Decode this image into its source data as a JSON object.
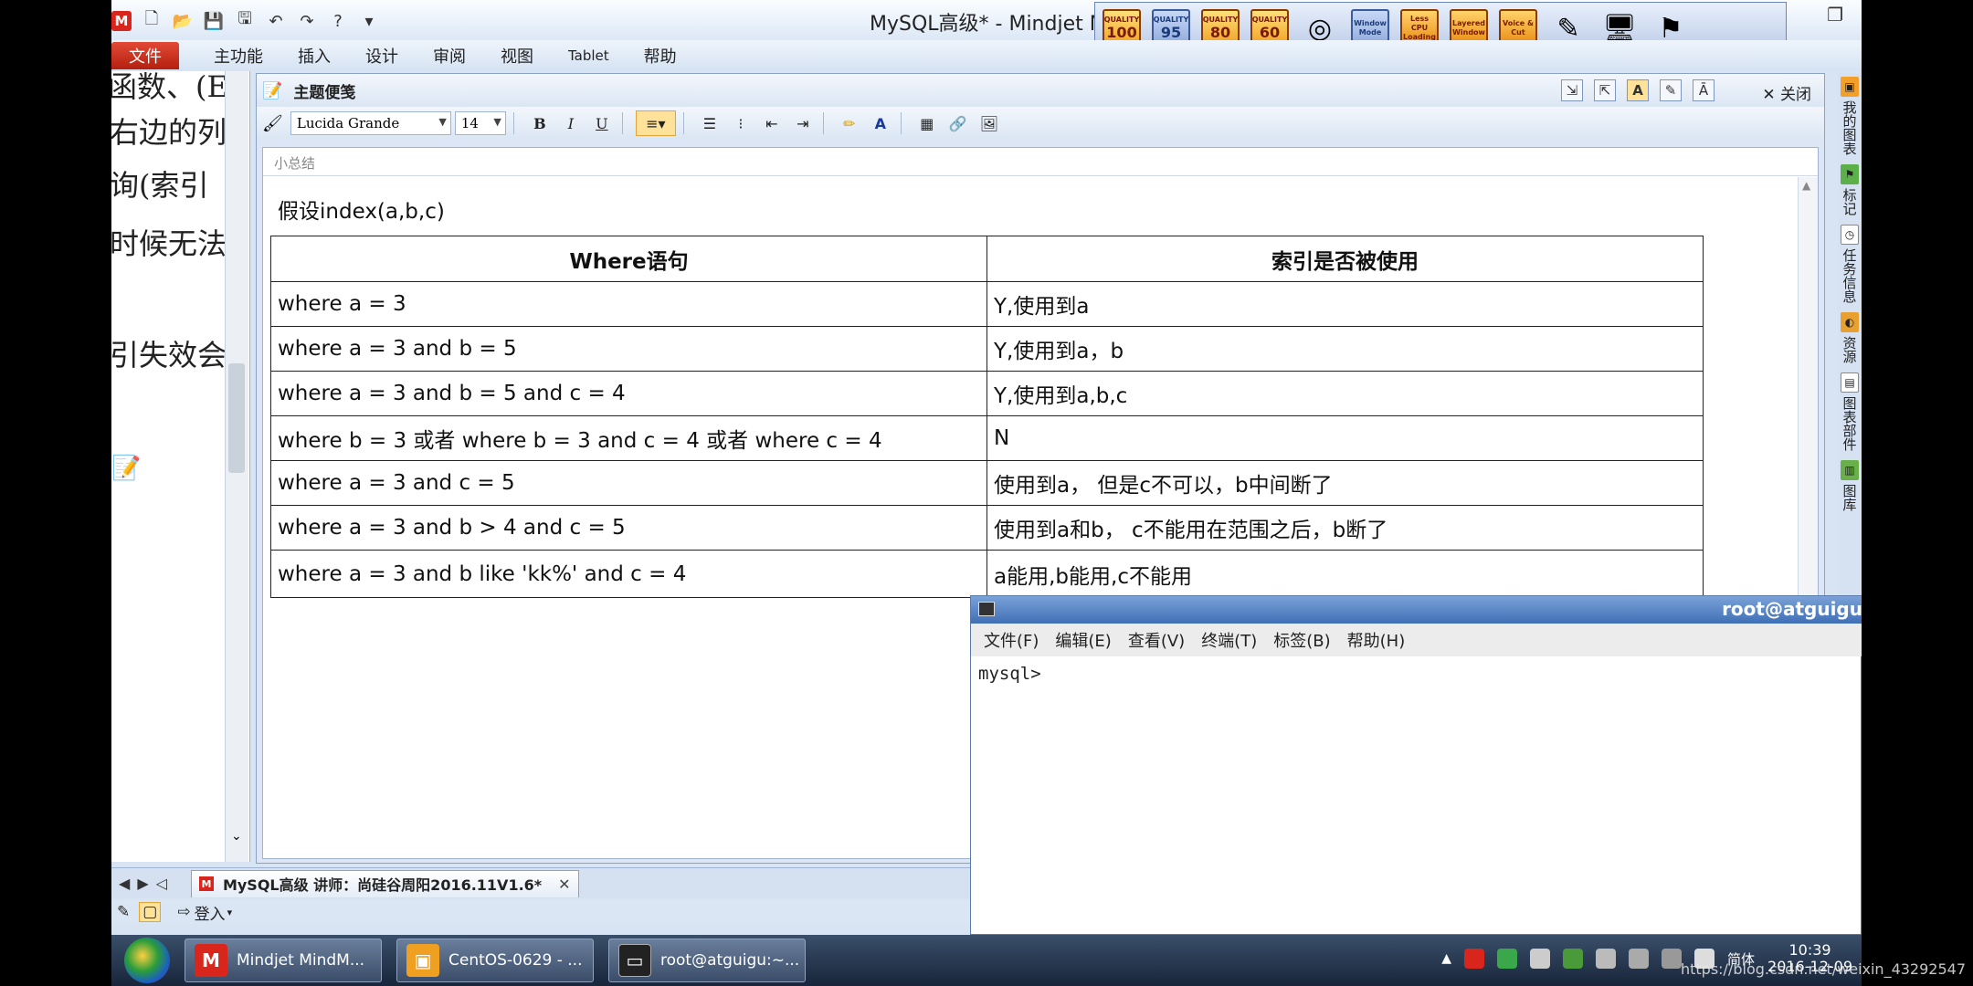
{
  "window": {
    "title": "MySQL高级* - Mindjet M",
    "app_icon_letter": "M"
  },
  "overlay_toolbar": {
    "quality_label": "QUALITY",
    "qualities": [
      "100",
      "95",
      "80",
      "60"
    ],
    "buttons": [
      "Window Mode",
      "Less CPU Loading",
      "Layered Window",
      "Voice & Cut"
    ]
  },
  "menubar": {
    "items": [
      "文件",
      "主功能",
      "插入",
      "设计",
      "审阅",
      "视图",
      "Tablet",
      "帮助"
    ]
  },
  "left_pane": {
    "lines": [
      "函数、(E",
      "右边的列",
      "询(索引",
      "时候无法",
      "引失效会"
    ]
  },
  "notes": {
    "title": "主题便笺",
    "close_label": "关闭",
    "font_name": "Lucida Grande",
    "font_size": "14",
    "topic": "小总结",
    "premise": "假设index(a,b,c)",
    "table": {
      "headers": [
        "Where语句",
        "索引是否被使用"
      ],
      "rows": [
        [
          "where a = 3",
          "Y,使用到a"
        ],
        [
          "where a = 3 and b = 5",
          "Y,使用到a，b"
        ],
        [
          "where a = 3 and b = 5 and c = 4",
          "Y,使用到a,b,c"
        ],
        [
          "where b = 3 或者 where b = 3 and c = 4  或者 where c = 4",
          "N"
        ],
        [
          "where a = 3 and c = 5",
          "使用到a， 但是c不可以，b中间断了"
        ],
        [
          "where a = 3 and b > 4 and c = 5",
          "使用到a和b， c不能用在范围之后，b断了"
        ],
        [
          "where a = 3 and b like 'kk%' and c = 4",
          "a能用,b能用,c不能用"
        ]
      ]
    }
  },
  "right_sidebar": {
    "tabs": [
      "我的图表",
      "标记",
      "任务信息",
      "资源",
      "图表部件",
      "图库"
    ]
  },
  "terminal": {
    "title": "root@atguigu",
    "menu": [
      "文件(F)",
      "编辑(E)",
      "查看(V)",
      "终端(T)",
      "标签(B)",
      "帮助(H)"
    ],
    "prompt": "mysql>"
  },
  "doc_tabs": {
    "active": "MySQL高级 讲师：尚硅谷周阳2016.11V1.6*"
  },
  "statusbar": {
    "login": "登入"
  },
  "taskbar": {
    "tasks": [
      "Mindjet MindM...",
      "CentOS-0629 - ...",
      "root@atguigu:~..."
    ],
    "ime": "简体",
    "time": "10:39",
    "date": "2016-12-09"
  },
  "watermark": "https://blog.csdn.net/weixin_43292547"
}
